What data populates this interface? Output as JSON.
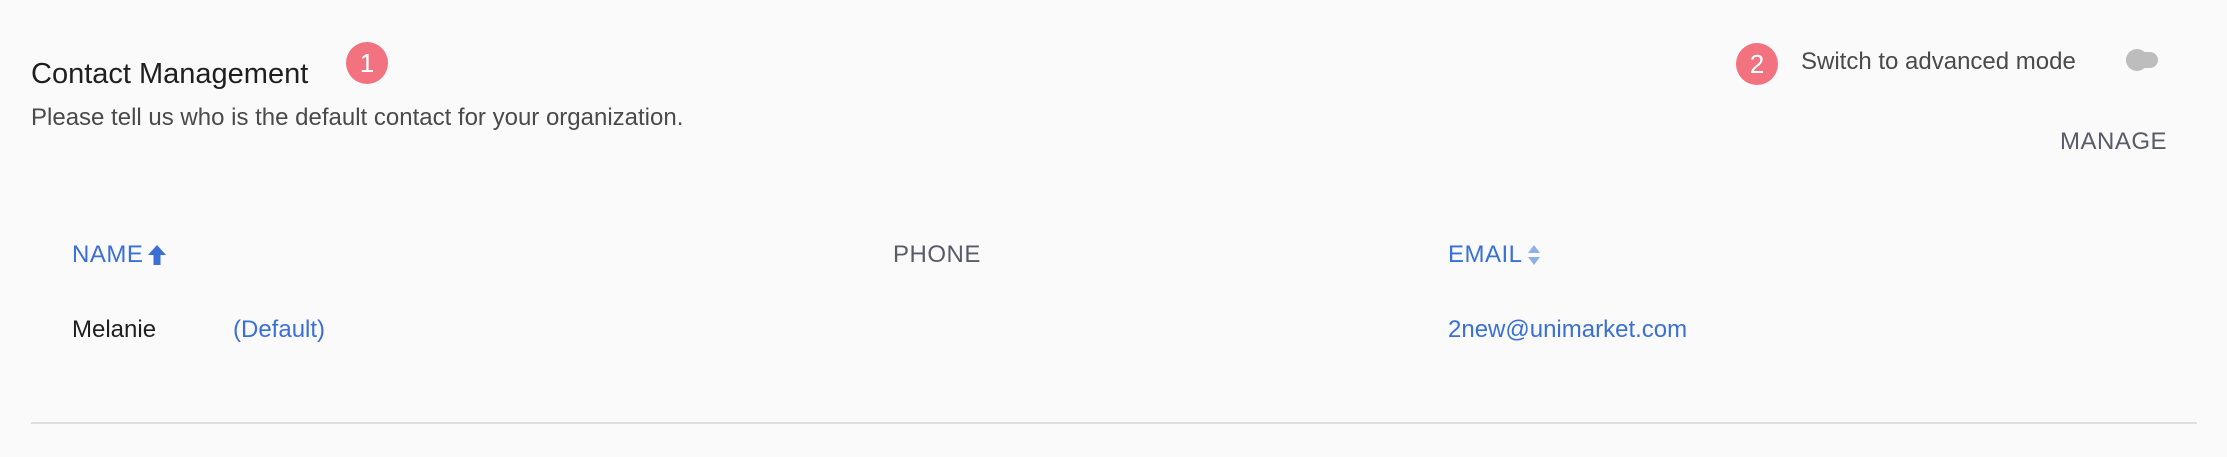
{
  "section": {
    "title": "Contact Management",
    "subtitle": "Please tell us who is the default contact for your organization.",
    "step_1": "1",
    "step_2": "2"
  },
  "advanced_mode": {
    "label": "Switch to advanced mode",
    "enabled": false
  },
  "actions": {
    "manage_label": "MANAGE"
  },
  "table": {
    "columns": [
      {
        "label": "NAME",
        "sort": "ascending",
        "icon": "arrow-up-icon"
      },
      {
        "label": "PHONE",
        "sort": "none"
      },
      {
        "label": "EMAIL",
        "sort": "sortable",
        "icon": "sort-icon"
      }
    ],
    "rows": [
      {
        "name": "Melanie",
        "tag": "(Default)",
        "phone": "",
        "email": "2new@unimarket.com"
      }
    ]
  },
  "colors": {
    "accent": "#3a6fd8",
    "badge": "#f2737f",
    "toggle_off": "#bdbdbd",
    "divider": "#dedede"
  }
}
